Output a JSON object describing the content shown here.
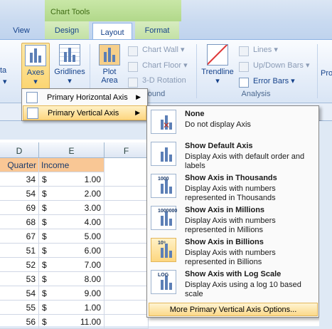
{
  "contextual_tab": "Chart Tools",
  "tabs": [
    "View",
    "Design",
    "Layout",
    "Format"
  ],
  "ribbon": {
    "partial_left": "ta",
    "axes": "Axes",
    "gridlines": "Gridlines",
    "plot_area": "Plot\nArea",
    "chart_wall": "Chart Wall",
    "chart_floor": "Chart Floor",
    "rotation_3d": "3-D Rotation",
    "background_group": "ound",
    "trendline": "Trendline",
    "lines": "Lines",
    "updown_bars": "Up/Down Bars",
    "error_bars": "Error Bars",
    "analysis_group": "Analysis",
    "partial_right": "Pro"
  },
  "axes_menu": [
    {
      "label": "Primary Horizontal Axis"
    },
    {
      "label": "Primary Vertical Axis"
    }
  ],
  "vertical_axis_menu": [
    {
      "title": "None",
      "desc": "Do not display Axis",
      "icon": "no-axis-icon"
    },
    {
      "title": "Show Default Axis",
      "desc": "Display Axis with default order and labels",
      "icon": "default-axis-icon"
    },
    {
      "title": "Show Axis in Thousands",
      "desc": "Display Axis with numbers represented in Thousands",
      "icon": "thousands-axis-icon",
      "tag": "1000"
    },
    {
      "title": "Show Axis in Millions",
      "desc": "Display Axis with numbers represented in Millions",
      "icon": "millions-axis-icon",
      "tag": "1000000"
    },
    {
      "title": "Show Axis in Billions",
      "desc": "Display Axis with numbers represented in Billions",
      "icon": "billions-axis-icon",
      "tag": "10⁹"
    },
    {
      "title": "Show Axis with Log Scale",
      "desc": "Display Axis using a log 10 based scale",
      "icon": "log-axis-icon",
      "tag": "LOG"
    }
  ],
  "more_options": "More Primary Vertical Axis Options...",
  "sheet": {
    "columns": [
      "D",
      "E",
      "F"
    ],
    "header_row": [
      "Quarter",
      "Income"
    ],
    "rows": [
      [
        "34",
        "$",
        "1.00"
      ],
      [
        "54",
        "$",
        "2.00"
      ],
      [
        "69",
        "$",
        "3.00"
      ],
      [
        "68",
        "$",
        "4.00"
      ],
      [
        "67",
        "$",
        "5.00"
      ],
      [
        "51",
        "$",
        "6.00"
      ],
      [
        "52",
        "$",
        "7.00"
      ],
      [
        "53",
        "$",
        "8.00"
      ],
      [
        "54",
        "$",
        "9.00"
      ],
      [
        "55",
        "$",
        "1.00"
      ],
      [
        "56",
        "$",
        "11.00"
      ]
    ]
  }
}
